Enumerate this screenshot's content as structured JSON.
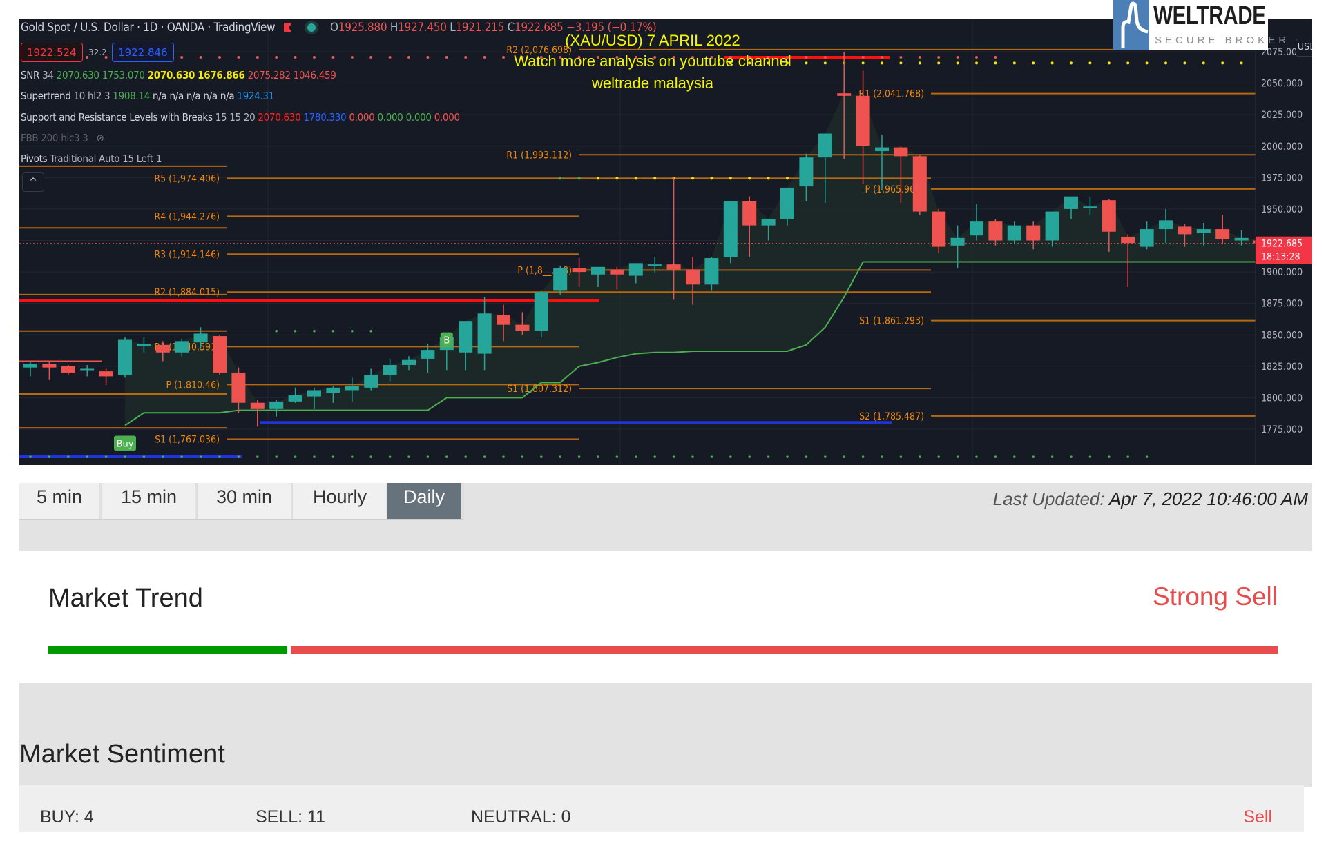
{
  "chart": {
    "symbol_line": "Gold Spot / U.S. Dollar · 1D · OANDA · TradingView",
    "ohlc": {
      "o_label": "O",
      "o": "1925.880",
      "h_label": "H",
      "h": "1927.450",
      "l_label": "L",
      "l": "1921.215",
      "c_label": "C",
      "c": "1922.685",
      "change": "−3.195 (−0.17%)"
    },
    "bid": "1922.524",
    "spread": "32.2",
    "ask": "1922.846",
    "indicators": {
      "snr": {
        "name": "SNR",
        "params": "34",
        "v1": "2070.630",
        "v2": "1753.070",
        "v3": "2070.630",
        "v4": "1676.866",
        "v5": "2075.282",
        "v6": "1046.459"
      },
      "supertrend": {
        "name": "Supertrend",
        "params": "10 hl2 3",
        "v1": "1908.14",
        "na": "n/a n/a n/a n/a n/a",
        "v2": "1924.31"
      },
      "srlb": {
        "name": "Support and Resistance Levels with Breaks",
        "params": "15 15 20",
        "v1": "2070.630",
        "v2": "1780.330",
        "v3": "0.000",
        "v4": "0.000",
        "v5": "0.000",
        "v6": "0.000"
      },
      "fbb": {
        "name": "FBB 200 hlc3 3"
      },
      "pivots": {
        "name": "Pivots",
        "params": "Traditional Auto 15 Left 1"
      }
    },
    "collapse_icon": "^",
    "overlay": {
      "line1": "(XAU/USD) 7 APRIL 2022",
      "line2": "Watch more analysis on youtube channel",
      "line3": "weltrade malaysia"
    },
    "logo": {
      "main": "WELTRADE",
      "sub": "SECURE BROKER"
    },
    "currency_button": "USD ⌄",
    "last_price": "1922.685",
    "countdown": "18:13:28",
    "buy_label": "Buy",
    "b_label": "B"
  },
  "chart_data": {
    "type": "candlestick",
    "title": "Gold Spot / U.S. Dollar · 1D · OANDA",
    "ylim": [
      1752,
      2098
    ],
    "y_ticks": [
      2075,
      2050,
      2025,
      2000,
      1975,
      1950,
      1925,
      1900,
      1875,
      1850,
      1825,
      1800,
      1775
    ],
    "y_tick_labels": [
      "2075.000",
      "2050.000",
      "2025.000",
      "2000.000",
      "1975.000",
      "1950.000",
      "",
      "1900.000",
      "1875.000",
      "1850.000",
      "1825.000",
      "1800.000",
      "1775.000"
    ],
    "candles": [
      [
        1824,
        1829,
        1817,
        1827
      ],
      [
        1827,
        1829,
        1814,
        1824
      ],
      [
        1825,
        1826,
        1818,
        1820
      ],
      [
        1822,
        1826,
        1817,
        1823
      ],
      [
        1821,
        1823,
        1810,
        1817
      ],
      [
        1818,
        1848,
        1816,
        1846
      ],
      [
        1841,
        1848,
        1836,
        1843
      ],
      [
        1842,
        1845,
        1829,
        1836
      ],
      [
        1836,
        1847,
        1833,
        1845
      ],
      [
        1844,
        1856,
        1839,
        1851
      ],
      [
        1849,
        1850,
        1818,
        1820
      ],
      [
        1820,
        1824,
        1788,
        1796
      ],
      [
        1796,
        1798,
        1777,
        1791
      ],
      [
        1791,
        1798,
        1785,
        1797
      ],
      [
        1797,
        1808,
        1796,
        1802
      ],
      [
        1801,
        1808,
        1791,
        1806
      ],
      [
        1804,
        1809,
        1796,
        1808
      ],
      [
        1806,
        1816,
        1797,
        1809
      ],
      [
        1808,
        1823,
        1806,
        1818
      ],
      [
        1818,
        1831,
        1813,
        1826
      ],
      [
        1826,
        1833,
        1822,
        1830
      ],
      [
        1831,
        1843,
        1820,
        1838
      ],
      [
        1838,
        1845,
        1822,
        1848
      ],
      [
        1836,
        1845,
        1822,
        1861
      ],
      [
        1835,
        1880,
        1822,
        1867
      ],
      [
        1866,
        1874,
        1845,
        1858
      ],
      [
        1858,
        1868,
        1850,
        1853
      ],
      [
        1853,
        1885,
        1848,
        1884
      ],
      [
        1885,
        1905,
        1882,
        1903
      ],
      [
        1903,
        1911,
        1888,
        1900
      ],
      [
        1898,
        1903,
        1888,
        1904
      ],
      [
        1902,
        1904,
        1886,
        1898
      ],
      [
        1897,
        1906,
        1891,
        1907
      ],
      [
        1906,
        1912,
        1899,
        1906
      ],
      [
        1906,
        1975,
        1878,
        1902
      ],
      [
        1902,
        1912,
        1874,
        1890
      ],
      [
        1890,
        1912,
        1885,
        1911
      ],
      [
        1912,
        1954,
        1907,
        1956
      ],
      [
        1956,
        1960,
        1912,
        1937
      ],
      [
        1937,
        1942,
        1925,
        1942
      ],
      [
        1942,
        1966,
        1937,
        1967
      ],
      [
        1968,
        1994,
        1956,
        1991
      ],
      [
        1991,
        2005,
        1955,
        2010
      ],
      [
        2042,
        2075,
        1990,
        2040
      ],
      [
        2040,
        2060,
        1970,
        2000
      ],
      [
        1996,
        2009,
        1965,
        1999
      ],
      [
        1999,
        2000,
        1955,
        1992
      ],
      [
        1992,
        1993,
        1945,
        1948
      ],
      [
        1948,
        1950,
        1915,
        1920
      ],
      [
        1921,
        1937,
        1903,
        1927
      ],
      [
        1929,
        1954,
        1925,
        1940
      ],
      [
        1940,
        1942,
        1921,
        1925
      ],
      [
        1925,
        1940,
        1922,
        1937
      ],
      [
        1937,
        1940,
        1918,
        1925
      ],
      [
        1925,
        1945,
        1920,
        1948
      ],
      [
        1950,
        1958,
        1942,
        1960
      ],
      [
        1952,
        1960,
        1945,
        1952
      ],
      [
        1957,
        1958,
        1916,
        1932
      ],
      [
        1928,
        1930,
        1888,
        1923
      ],
      [
        1920,
        1940,
        1918,
        1934
      ],
      [
        1934,
        1950,
        1923,
        1941
      ],
      [
        1936,
        1938,
        1920,
        1930
      ],
      [
        1931,
        1939,
        1921,
        1934
      ],
      [
        1934,
        1945,
        1922,
        1926
      ],
      [
        1925,
        1933,
        1921,
        1927
      ],
      [
        1925,
        1927,
        1921,
        1922.685
      ]
    ],
    "candle_format": "[open, high, low, close]",
    "pivot_levels": [
      {
        "label": "R5 (1,974.406)",
        "value": 1974.406,
        "period": 1
      },
      {
        "label": "R4 (1,944.276)",
        "value": 1944.276,
        "period": 1
      },
      {
        "label": "R3 (1,914.146)",
        "value": 1914.146,
        "period": 1
      },
      {
        "label": "R2 (1,884.015)",
        "value": 1884.015,
        "period": 1
      },
      {
        "label": "R1 (1,840.591)",
        "value": 1840.591,
        "period": 1
      },
      {
        "label": "P (1,810.46)",
        "value": 1810.46,
        "period": 1
      },
      {
        "label": "S1 (1,767.036)",
        "value": 1767.036,
        "period": 1
      },
      {
        "label": "R2 (2,076.698)",
        "value": 2076.698,
        "period": 2
      },
      {
        "label": "R1 (1,993.112)",
        "value": 1993.112,
        "period": 2
      },
      {
        "label": "P (1,8__.__8)",
        "value": 1901.5,
        "period": 2
      },
      {
        "label": "S1 (1,807.312)",
        "value": 1807.312,
        "period": 2
      },
      {
        "label": "R1 (2,041.768)",
        "value": 2041.768,
        "period": 3
      },
      {
        "label": "P (1,965.962)",
        "value": 1965.962,
        "period": 3
      },
      {
        "label": "S1 (1,861.293)",
        "value": 1861.293,
        "period": 3
      },
      {
        "label": "S2 (1,785.487)",
        "value": 1785.487,
        "period": 3
      }
    ],
    "extra_lines": {
      "resistance_red": 1877,
      "resistance_red_top": 2070.63,
      "support_blue_1": 1753.07,
      "support_blue_2": 1780.33,
      "last_price_line": 1922.685,
      "supertrend": [
        1778,
        1778,
        1778,
        1778,
        1778,
        1778,
        1788,
        1788,
        1788,
        1788,
        1788,
        1790,
        1790,
        1790,
        1790,
        1790,
        1790,
        1790,
        1790,
        1790,
        1790,
        1790,
        1800,
        1800,
        1800,
        1800,
        1800,
        1812,
        1812,
        1825,
        1828,
        1832,
        1835,
        1836,
        1836,
        1837,
        1837,
        1837,
        1837,
        1837,
        1837,
        1842,
        1856,
        1880,
        1908,
        1908,
        1908,
        1908,
        1908,
        1908,
        1908,
        1908,
        1908,
        1908,
        1908,
        1908,
        1908,
        1908,
        1908,
        1908,
        1908,
        1908,
        1908,
        1908,
        1908,
        1908
      ]
    }
  },
  "timeframe_tabs": [
    {
      "label": "5 min",
      "active": false
    },
    {
      "label": "15 min",
      "active": false
    },
    {
      "label": "30 min",
      "active": false
    },
    {
      "label": "Hourly",
      "active": false
    },
    {
      "label": "Daily",
      "active": true
    }
  ],
  "last_updated": {
    "label": "Last Updated:",
    "value": "Apr 7, 2022 10:46:00 AM"
  },
  "market_trend": {
    "title": "Market Trend",
    "value": "Strong Sell",
    "buy_fraction": 0.196,
    "colors": {
      "buy": "#009900",
      "sell": "#e84c4c"
    }
  },
  "market_sentiment": {
    "title": "Market Sentiment",
    "buy": "BUY: 4",
    "sell": "SELL: 11",
    "neutral": "NEUTRAL: 0",
    "signal": "Sell"
  }
}
